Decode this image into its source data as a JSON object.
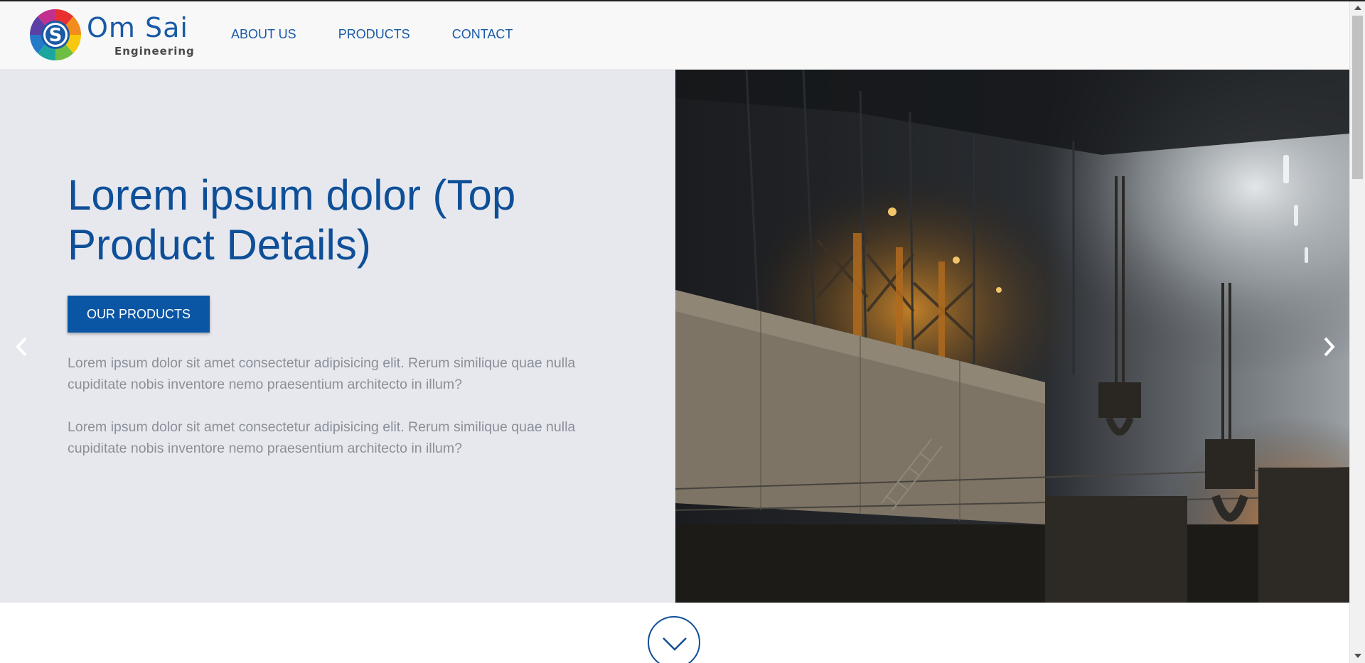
{
  "brand": {
    "name": "Om Sai",
    "tagline": "Engineering",
    "logo_letter": "S",
    "colors": {
      "primary": "#0e4f98",
      "nav": "#1a5aa6",
      "hero_bg": "#e7e8ee",
      "body_text": "#8b8f98"
    }
  },
  "nav": {
    "items": [
      {
        "label": "ABOUT US"
      },
      {
        "label": "PRODUCTS"
      },
      {
        "label": "CONTACT"
      }
    ]
  },
  "hero": {
    "title": "Lorem ipsum dolor (Top Product Details)",
    "cta_label": "OUR PRODUCTS",
    "paragraphs": [
      "Lorem ipsum dolor sit amet consectetur adipisicing elit. Rerum similique quae nulla cupiditate nobis inventore nemo praesentium architecto in illum?",
      "Lorem ipsum dolor sit amet consectetur adipisicing elit. Rerum similique quae nulla cupiditate nobis inventore nemo praesentium architecto in illum?"
    ],
    "image_subject": "industrial-steel-plant-interior",
    "prev_icon": "chevron-left-icon",
    "next_icon": "chevron-right-icon"
  },
  "scroll_down": {
    "icon": "chevron-down-icon"
  }
}
